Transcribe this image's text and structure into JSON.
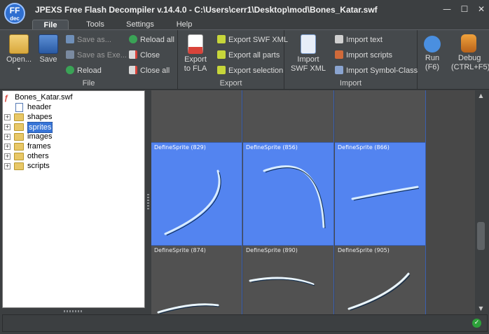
{
  "window": {
    "logo_text": "FF",
    "logo_sub": "dec",
    "title": "JPEXS Free Flash Decompiler v.14.4.0 - C:\\Users\\cerr1\\Desktop\\mod\\Bones_Katar.swf",
    "minimize": "—",
    "maximize": "☐",
    "close": "✕"
  },
  "menu": {
    "tabs": [
      "File",
      "Tools",
      "Settings",
      "Help"
    ],
    "active_tab": "File"
  },
  "ribbon": {
    "file_group": {
      "label": "File",
      "open": "Open...",
      "save": "Save",
      "save_as": "Save as...",
      "save_as_exe": "Save as Exe...",
      "reload": "Reload",
      "reload_all": "Reload all",
      "close": "Close",
      "close_all": "Close all"
    },
    "export_group": {
      "label": "Export",
      "export_fla_line1": "Export",
      "export_fla_line2": "to FLA",
      "export_swf_xml": "Export SWF XML",
      "export_all_parts": "Export all parts",
      "export_selection": "Export selection"
    },
    "import_group": {
      "label": "Import",
      "import_swf_xml_line1": "Import",
      "import_swf_xml_line2": "SWF XML",
      "import_text": "Import text",
      "import_scripts": "Import scripts",
      "import_symbol_class": "Import Symbol-Class"
    },
    "run_group": {
      "run_line1": "Run",
      "run_line2": "(F6)",
      "debug_line1": "Debug",
      "debug_line2": "(CTRL+F5)"
    },
    "icon_names": [
      "open-folder-icon",
      "floppy-disk-icon",
      "fla-file-icon",
      "xml-import-icon",
      "play-icon",
      "debug-bug-icon"
    ],
    "accent_color": "#2f6fd0"
  },
  "tree": {
    "root": "Bones_Katar.swf",
    "items": [
      {
        "label": "header",
        "expandable": false
      },
      {
        "label": "shapes",
        "expandable": true
      },
      {
        "label": "sprites",
        "expandable": true,
        "selected": true
      },
      {
        "label": "images",
        "expandable": true
      },
      {
        "label": "frames",
        "expandable": true
      },
      {
        "label": "others",
        "expandable": true
      },
      {
        "label": "scripts",
        "expandable": true
      }
    ]
  },
  "grid": {
    "rows": [
      {
        "selected": false,
        "cells": [
          "",
          "",
          ""
        ]
      },
      {
        "selected": true,
        "cells": [
          "DefineSprite (829)",
          "DefineSprite (856)",
          "DefineSprite (866)"
        ]
      },
      {
        "selected": false,
        "cells": [
          "DefineSprite (874)",
          "DefineSprite (890)",
          "DefineSprite (905)"
        ]
      }
    ],
    "selection_color": "#5384f0"
  },
  "status": {
    "ok_icon": "✓"
  }
}
